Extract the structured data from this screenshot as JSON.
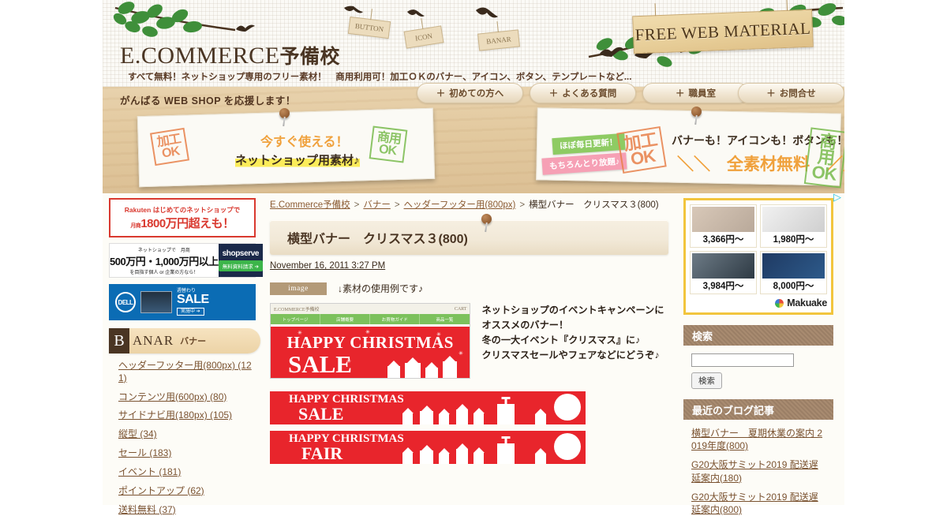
{
  "header": {
    "site_title_en": "E.COMMERCE",
    "site_title_jp": "予備校",
    "tagline": "すべて無料！ネットショップ専用のフリー素材！　商用利用可！加工ＯＫのバナー、アイコン、ボタン、テンプレートなど...",
    "free_sign": "FREE WEB MATERIAL",
    "hangtags": [
      "BUTTON",
      "ICON",
      "BANAR"
    ]
  },
  "nav": {
    "items": [
      {
        "label": "初めての方へ",
        "plus": "＋"
      },
      {
        "label": "よくある質問",
        "plus": "＋"
      },
      {
        "label": "職員室",
        "plus": "＋"
      },
      {
        "label": "お問合せ",
        "plus": "＋"
      }
    ]
  },
  "hero": {
    "heading": "がんばる WEB SHOP を応援します！",
    "paper_left": {
      "line1": "今すぐ使える！",
      "line2": "ネットショップ用素材♪",
      "stamp_left": "加工\nOK",
      "stamp_right": "商用\nOK"
    },
    "paper_right": {
      "ribbon_green": "ほぼ毎日更新！",
      "ribbon_pink": "もちろんとり放題♪",
      "line1": "バナーも！アイコンも！ボタンも！！",
      "line2": "＼＼　全素材無料　／／",
      "stamp_left": "加工\nOK",
      "stamp_right": "商用\nOK"
    }
  },
  "left_sidebar": {
    "ads": {
      "rakuten": {
        "brand": "Rakuten",
        "line1": "はじめてのネットショップで",
        "prefix": "月商",
        "line2": "1800万円超えも！"
      },
      "shopserve": {
        "a": "ネットショップで　月商",
        "b": "500万円・1,000万円以上",
        "c": "を目指す個人 or 企業の方なら！",
        "brand": "shopserve",
        "cta": "無料資料請求 ➔"
      },
      "dell": {
        "brand": "DELL",
        "s1": "週替わり",
        "s2": "SALE",
        "s3": "実施中 ➔"
      }
    },
    "category": {
      "initial": "B",
      "title_en": "ANAR",
      "title_jp": "バナー",
      "links": [
        "ヘッダーフッター用(800px) (121)",
        "コンテンツ用(600px) (80)",
        "サイドナビ用(180px) (105)",
        "縦型 (34)",
        "セール (183)",
        "イベント (181)",
        "ポイントアップ (62)",
        "送料無料 (37)"
      ]
    }
  },
  "main": {
    "breadcrumb": {
      "items": [
        "E.Commerce予備校",
        "バナー",
        "ヘッダーフッター用(800px)"
      ],
      "current": "横型バナー　クリスマス３(800)",
      "separator": ">"
    },
    "post_title": "横型バナー　クリスマス３(800)",
    "post_date": "November 16, 2011 3:27 PM",
    "image_tag": "image",
    "usage_note": "↓素材の使用例です♪",
    "screenshot": {
      "brand": "E.COMMERCE予備校",
      "corner": "CART",
      "nav": [
        "トップページ",
        "店舗概要",
        "お買物ガイド",
        "商品一覧"
      ],
      "banner_line1": "HAPPY CHRISTMAS",
      "banner_line2": "SALE"
    },
    "description": "ネットショップのイベントキャンペーンにオススメのバナー！\n冬の一大イベント『クリスマス』に♪\nクリスマスセールやフェアなどにどうぞ♪",
    "banners": [
      {
        "line1": "HAPPY CHRISTMAS",
        "line2": "SALE"
      },
      {
        "line1": "HAPPY CHRISTMAS",
        "line2": "FAIR"
      }
    ]
  },
  "right_sidebar": {
    "makuake": {
      "brand": "Makuake",
      "adchoices": "▷",
      "items": [
        {
          "price": "3,366円～"
        },
        {
          "price": "1,980円～"
        },
        {
          "price": "3,984円～"
        },
        {
          "price": "8,000円～"
        }
      ]
    },
    "search": {
      "heading": "検索",
      "value": "",
      "placeholder": "",
      "button": "検索"
    },
    "blog": {
      "heading": "最近のブログ記事",
      "items": [
        "横型バナー　夏期休業の案内 2019年度(800)",
        "G20大阪サミット2019 配送遅延案内(180)",
        "G20大阪サミット2019 配送遅延案内(800)"
      ]
    }
  },
  "colors": {
    "brown": "#4a3523",
    "link": "#7a5230",
    "red": "#e8252c",
    "yellow": "#f2c53d",
    "green": "#7cc15c"
  }
}
